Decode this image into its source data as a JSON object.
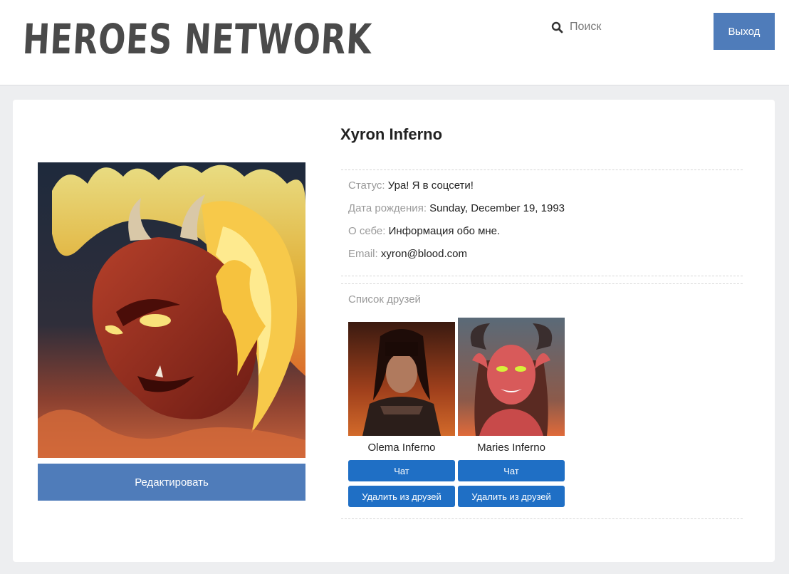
{
  "header": {
    "logo_text": "HEROES NETWORK",
    "search_placeholder": "Поиск",
    "logout_label": "Выход"
  },
  "profile": {
    "name": "Xyron Inferno",
    "edit_label": "Редактировать",
    "fields": [
      {
        "label": "Статус:",
        "value": "Ура! Я в соцсети!"
      },
      {
        "label": "Дата рождения:",
        "value": "Sunday, December 19, 1993"
      },
      {
        "label": "О себе:",
        "value": "Информация обо мне."
      },
      {
        "label": "Email:",
        "value": "xyron@blood.com"
      }
    ]
  },
  "friends": {
    "title": "Список друзей",
    "items": [
      {
        "name": "Olema Inferno",
        "chat_label": "Чат",
        "remove_label": "Удалить из друзей"
      },
      {
        "name": "Maries Inferno",
        "chat_label": "Чат",
        "remove_label": "Удалить из друзей"
      }
    ]
  },
  "colors": {
    "primary_button": "#4f7cba",
    "friend_button": "#1f6fc5",
    "background": "#edeef0"
  }
}
